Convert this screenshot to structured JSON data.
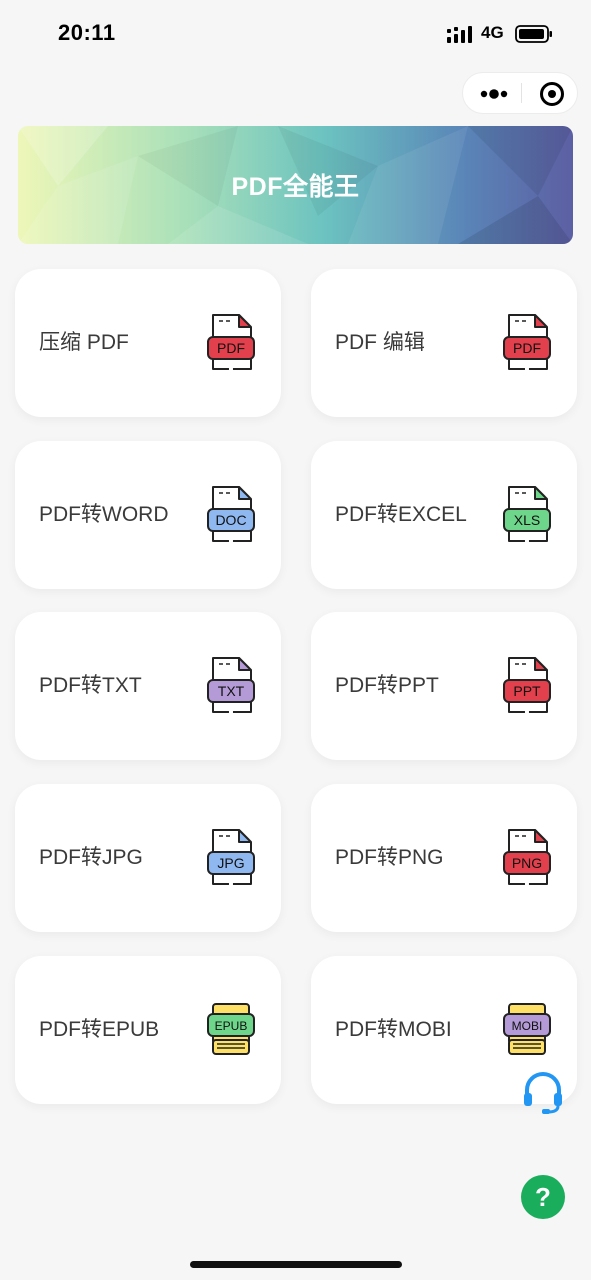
{
  "status_bar": {
    "time": "20:11",
    "network": "4G"
  },
  "banner": {
    "title": "PDF全能王"
  },
  "tools": [
    {
      "label": "压缩 PDF",
      "icon": "pdf-file-icon",
      "badge": "PDF",
      "color": "#e2404d"
    },
    {
      "label": "PDF 编辑",
      "icon": "pdf-file-icon",
      "badge": "PDF",
      "color": "#e2404d"
    },
    {
      "label": "PDF转WORD",
      "icon": "doc-file-icon",
      "badge": "DOC",
      "color": "#8fb8f0"
    },
    {
      "label": "PDF转EXCEL",
      "icon": "xls-file-icon",
      "badge": "XLS",
      "color": "#6ed68a"
    },
    {
      "label": "PDF转TXT",
      "icon": "txt-file-icon",
      "badge": "TXT",
      "color": "#b49ad6"
    },
    {
      "label": "PDF转PPT",
      "icon": "ppt-file-icon",
      "badge": "PPT",
      "color": "#e2404d"
    },
    {
      "label": "PDF转JPG",
      "icon": "jpg-file-icon",
      "badge": "JPG",
      "color": "#8fb8f0"
    },
    {
      "label": "PDF转PNG",
      "icon": "png-file-icon",
      "badge": "PNG",
      "color": "#e2404d"
    },
    {
      "label": "PDF转EPUB",
      "icon": "epub-book-icon",
      "badge": "EPUB",
      "color": "#6ed68a"
    },
    {
      "label": "PDF转MOBI",
      "icon": "mobi-book-icon",
      "badge": "MOBI",
      "color": "#b49ad6"
    }
  ],
  "help": {
    "label": "?"
  },
  "colors": {
    "background": "#f6f6f6",
    "card": "#ffffff",
    "help_green": "#1aad5c",
    "service_blue": "#2196f3"
  }
}
